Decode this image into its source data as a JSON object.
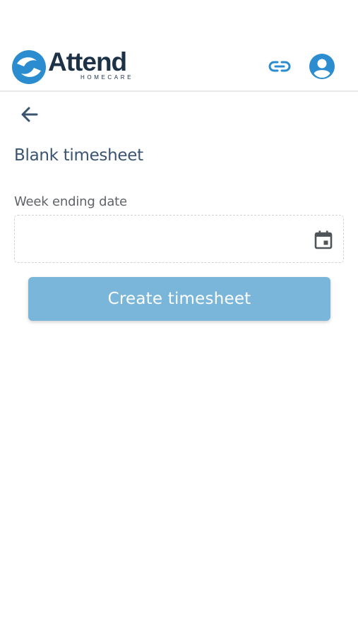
{
  "header": {
    "brand_name": "Attend",
    "brand_tagline": "HOMECARE",
    "link_icon": "link-icon",
    "avatar_icon": "account-circle-icon"
  },
  "nav": {
    "back_icon": "arrow-left-icon"
  },
  "page": {
    "title": "Blank timesheet"
  },
  "form": {
    "week_ending_label": "Week ending date",
    "week_ending_value": "",
    "calendar_icon": "calendar-icon",
    "submit_label": "Create timesheet"
  },
  "colors": {
    "brand_navy": "#1d3147",
    "brand_blue": "#2b8ccf",
    "title_text": "#3a5470",
    "button_bg": "#7ab6d9",
    "icon_color": "#3a5470"
  }
}
